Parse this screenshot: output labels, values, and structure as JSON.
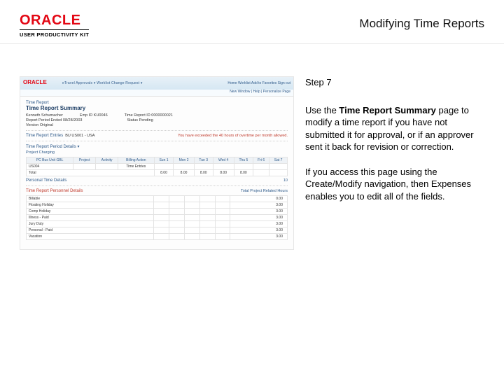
{
  "header": {
    "logo_text": "ORACLE",
    "logo_subtitle": "USER PRODUCTIVITY KIT",
    "page_title": "Modifying Time Reports"
  },
  "instruction": {
    "step_label": "Step 7",
    "p1_pre": "Use the ",
    "p1_bold": "Time Report Summary",
    "p1_post": " page to modify a time report if you have not submitted it for approval, or if an approver sent it back for revision or correction.",
    "p2": "If you access this page using the Create/Modify navigation, then Expenses enables you to edit all of the fields."
  },
  "app": {
    "mini_logo": "ORACLE",
    "menu": "eTravel    Approvals ▾    Worklist    Change Request ▾",
    "right_menu": "Home   Worklist   Add to Favorites   Sign out",
    "breadcrumb": "New Window | Help | Personalize Page",
    "tr_label": "Time Report",
    "tr_title": "Time Report Summary",
    "name": "Kenneth Schumacher",
    "emp_id_label": "Emp ID",
    "emp_id": "KU0046",
    "tr_id_label": "Time Report ID",
    "tr_id": "0000000021",
    "period_label": "Report Period Ended",
    "period": "08/28/2003",
    "status_label": "Status",
    "status": "Pending",
    "version_label": "Version",
    "version": "Original",
    "policy_label": "Time Report Entries",
    "policy_bu": "BU   US001 - USA",
    "policy_warn": "You have exceeded the 40 hours of overtime per month allowed.",
    "period_detail": "Time Report Period Details  ▾",
    "pc_header": "Project Charging",
    "th": [
      "PC Bus Unit GBL",
      "Project",
      "Activity",
      "Billing Action",
      "Sun 1",
      "Mon 2",
      "Tue 3",
      "Wed 4",
      "Thu 5",
      "Fri 6",
      "Sat 7"
    ],
    "row1": [
      "US004",
      "",
      "",
      "Time Entries",
      "",
      "",
      "",
      "",
      "",
      "",
      ""
    ],
    "row2_label": "Total",
    "row2": [
      "",
      "",
      "",
      "",
      "8.00",
      "8.00",
      "8.00",
      "8.00",
      "8.00",
      ""
    ],
    "personal_detail": "Personal Time Details",
    "amt_section": "Time Report Personnel Details",
    "right_link": "Total Project Related Hours",
    "amt_rows": [
      [
        "Billable",
        "0.00"
      ],
      [
        "Floating Holiday",
        "3.00"
      ],
      [
        "Comp Holiday",
        "3.00"
      ],
      [
        "Illness - Paid",
        "3.00"
      ],
      [
        "Jury Duty",
        "3.00"
      ],
      [
        "Personal - Paid",
        "3.00"
      ],
      [
        "Vacation",
        "3.00"
      ]
    ]
  }
}
